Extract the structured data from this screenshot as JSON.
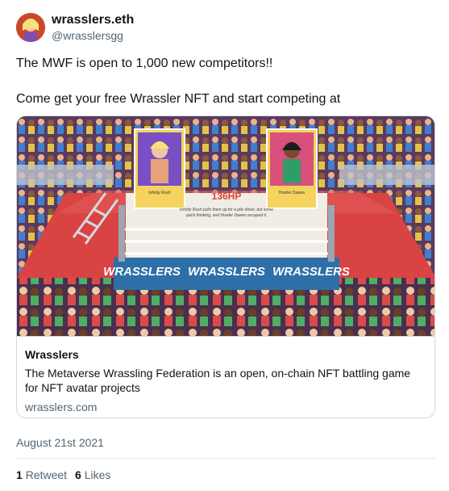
{
  "author": {
    "display_name": "wrasslers.eth",
    "handle": "@wrasslersgg"
  },
  "tweet": {
    "lines": [
      "The MWF is open to 1,000 new competitors!!",
      "Come get your free Wrassler NFT and start competing at"
    ]
  },
  "card": {
    "image": {
      "hp_text": "136HP",
      "caption_line1": "Infinity Rush pulls them up for a pile driver, but some",
      "caption_line2": "quick thinking, and Howler Dawes escaped it.",
      "banner_text": "WRASSLERS",
      "fighter_left": "Infinity Rush",
      "fighter_right": "Howler Dawes"
    },
    "title": "Wrasslers",
    "description": "The Metaverse Wrassling Federation is an open, on-chain NFT battling game for NFT avatar projects",
    "domain": "wrasslers.com"
  },
  "date": "August 21st 2021",
  "stats": {
    "retweet_count": "1",
    "retweet_label": "Retweet",
    "like_count": "6",
    "like_label": "Likes"
  }
}
